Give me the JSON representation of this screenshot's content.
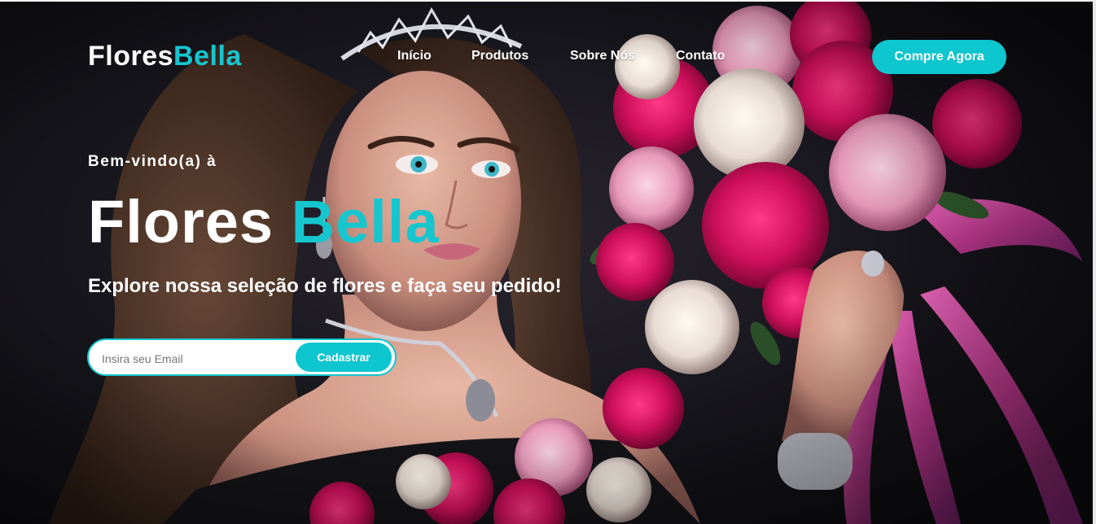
{
  "brand": {
    "name_part1": "Flores",
    "name_part2": "Bella"
  },
  "nav": {
    "items": [
      {
        "label": "Início"
      },
      {
        "label": "Produtos"
      },
      {
        "label": "Sobre Nós"
      },
      {
        "label": "Contato"
      }
    ],
    "cta_label": "Compre Agora"
  },
  "hero": {
    "welcome": "Bem-vindo(a) à",
    "title_part1": "Flores",
    "title_part2": "Bella",
    "subtitle": "Explore nossa seleção de flores e faça seu pedido!"
  },
  "signup": {
    "email_placeholder": "Insira seu Email",
    "email_value": "",
    "submit_label": "Cadastrar"
  },
  "colors": {
    "accent": "#16c6cf",
    "button": "#0ec6cd",
    "background": "#15141a",
    "text": "#ffffff"
  },
  "background_image": {
    "subject": "woman-with-tiara-holding-rose-bouquet-photo"
  }
}
